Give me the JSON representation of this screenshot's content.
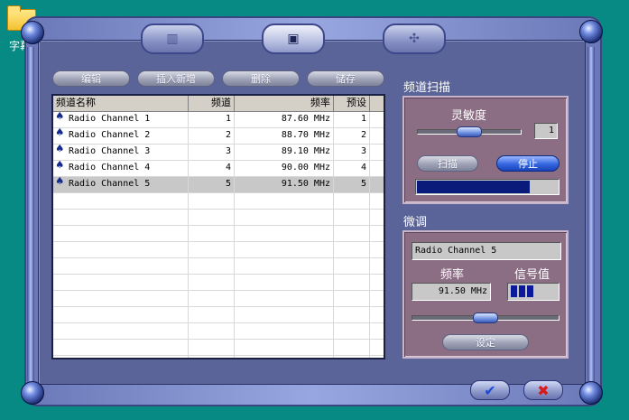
{
  "desktop": {
    "icon_label": "字幕"
  },
  "top_tabs": [
    {
      "icon": "film-icon"
    },
    {
      "icon": "radio-icon"
    },
    {
      "icon": "gear-icon"
    }
  ],
  "toolbar": {
    "edit": "编辑",
    "insert": "插入新增",
    "delete": "删除",
    "save": "储存"
  },
  "table": {
    "headers": [
      "频道名称",
      "频道",
      "频率",
      "预设"
    ],
    "rows": [
      {
        "name": "Radio Channel 1",
        "channel": "1",
        "freq": "87.60 MHz",
        "preset": "1"
      },
      {
        "name": "Radio Channel 2",
        "channel": "2",
        "freq": "88.70 MHz",
        "preset": "2"
      },
      {
        "name": "Radio Channel 3",
        "channel": "3",
        "freq": "89.10 MHz",
        "preset": "3"
      },
      {
        "name": "Radio Channel 4",
        "channel": "4",
        "freq": "90.00 MHz",
        "preset": "4"
      },
      {
        "name": "Radio Channel 5",
        "channel": "5",
        "freq": "91.50 MHz",
        "preset": "5"
      }
    ],
    "selected_index": 4
  },
  "scan": {
    "title": "频道扫描",
    "sensitivity_label": "灵敏度",
    "sensitivity_value": "1",
    "sensitivity_level": 0.5,
    "scan_button": "扫描",
    "stop_button": "停止",
    "progress": 0.8
  },
  "tune": {
    "title": "微调",
    "channel_name": "Radio Channel 5",
    "freq_label": "频率",
    "signal_label": "信号值",
    "freq_value": "91.50 MHz",
    "signal_bars": 3,
    "tune_level": 0.5,
    "set_button": "设定"
  },
  "footer": {
    "ok_symbol": "✔",
    "cancel_symbol": "✖"
  },
  "colors": {
    "desktop": "#078a83",
    "frame": "#8a96d0",
    "panel": "#8c6e84",
    "selection": "#c8c8c8",
    "accent": "#0a1a7a"
  }
}
